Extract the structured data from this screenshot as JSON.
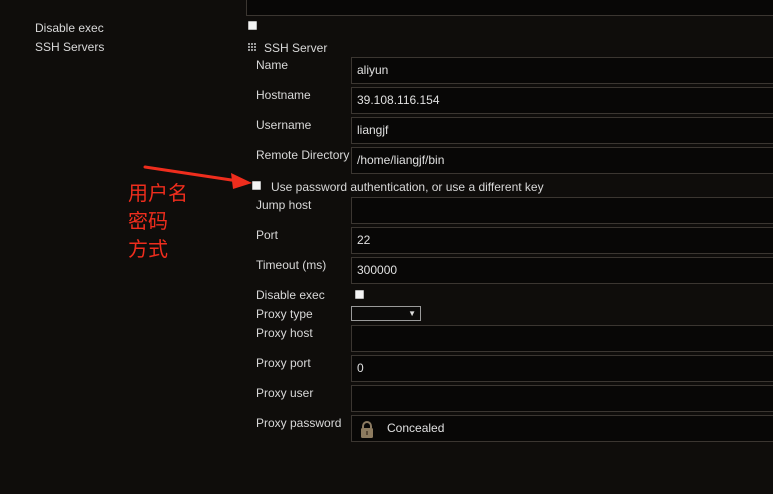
{
  "left_panel": {
    "disable_exec_label": "Disable exec",
    "ssh_servers_label": "SSH Servers"
  },
  "ssh_server": {
    "section_title": "SSH Server",
    "fields": {
      "name": {
        "label": "Name",
        "value": "aliyun"
      },
      "hostname": {
        "label": "Hostname",
        "value": "39.108.116.154"
      },
      "username": {
        "label": "Username",
        "value": "liangjf"
      },
      "remote_directory": {
        "label": "Remote Directory",
        "value": "/home/liangjf/bin"
      },
      "use_password_auth": {
        "label": "Use password authentication, or use a different key",
        "checked": false
      },
      "jump_host": {
        "label": "Jump host",
        "value": ""
      },
      "port": {
        "label": "Port",
        "value": "22"
      },
      "timeout": {
        "label": "Timeout (ms)",
        "value": "300000"
      },
      "disable_exec": {
        "label": "Disable exec",
        "checked": false
      },
      "proxy_type": {
        "label": "Proxy type",
        "selected": ""
      },
      "proxy_host": {
        "label": "Proxy host",
        "value": ""
      },
      "proxy_port": {
        "label": "Proxy port",
        "value": "0"
      },
      "proxy_user": {
        "label": "Proxy user",
        "value": ""
      },
      "proxy_password": {
        "label": "Proxy password",
        "value": "Concealed",
        "icon": "lock-icon"
      }
    }
  },
  "annotation": {
    "line1": "用户名",
    "line2": "密码",
    "line3": "方式",
    "color": "#ef2d1d"
  },
  "icons": {
    "section_handle": "grip-icon",
    "arrow": "red-arrow-icon",
    "select_arrow": "chevron-down-icon",
    "lock": "lock-icon"
  }
}
